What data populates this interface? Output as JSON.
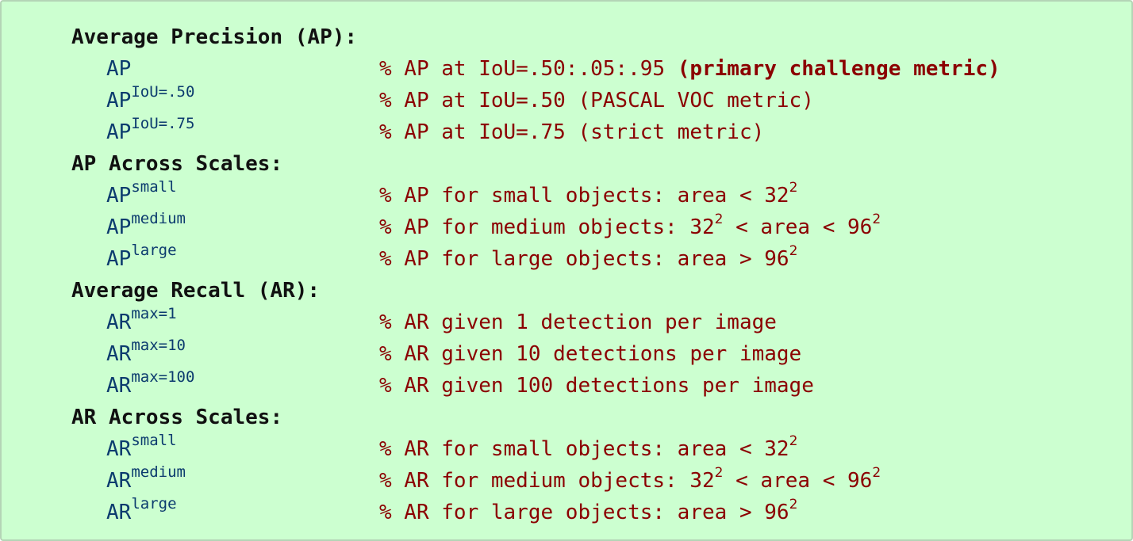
{
  "sections": [
    {
      "heading": "Average Precision (AP):",
      "rows": [
        {
          "base": "AP",
          "sup": "",
          "desc": [
            {
              "t": "% AP at IoU=.50:.05:.95 "
            },
            {
              "t": "(primary challenge metric)",
              "b": true
            }
          ]
        },
        {
          "base": "AP",
          "sup": "IoU=.50",
          "desc": [
            {
              "t": "% AP at IoU=.50 (PASCAL VOC metric)"
            }
          ]
        },
        {
          "base": "AP",
          "sup": "IoU=.75",
          "desc": [
            {
              "t": "% AP at IoU=.75 (strict metric)"
            }
          ]
        }
      ]
    },
    {
      "heading": "AP Across Scales:",
      "rows": [
        {
          "base": "AP",
          "sup": "small",
          "desc": [
            {
              "t": "% AP for small objects: area < 32"
            },
            {
              "t": "2",
              "s": true
            }
          ]
        },
        {
          "base": "AP",
          "sup": "medium",
          "desc": [
            {
              "t": "% AP for medium objects: 32"
            },
            {
              "t": "2",
              "s": true
            },
            {
              "t": " < area < 96"
            },
            {
              "t": "2",
              "s": true
            }
          ]
        },
        {
          "base": "AP",
          "sup": "large",
          "desc": [
            {
              "t": "% AP for large objects: area > 96"
            },
            {
              "t": "2",
              "s": true
            }
          ]
        }
      ]
    },
    {
      "heading": "Average Recall (AR):",
      "rows": [
        {
          "base": "AR",
          "sup": "max=1",
          "desc": [
            {
              "t": "% AR given 1 detection per image"
            }
          ]
        },
        {
          "base": "AR",
          "sup": "max=10",
          "desc": [
            {
              "t": "% AR given 10 detections per image"
            }
          ]
        },
        {
          "base": "AR",
          "sup": "max=100",
          "desc": [
            {
              "t": "% AR given 100 detections per image"
            }
          ]
        }
      ]
    },
    {
      "heading": "AR Across Scales:",
      "rows": [
        {
          "base": "AR",
          "sup": "small",
          "desc": [
            {
              "t": "% AR for small objects: area < 32"
            },
            {
              "t": "2",
              "s": true
            }
          ]
        },
        {
          "base": "AR",
          "sup": "medium",
          "desc": [
            {
              "t": "% AR for medium objects: 32"
            },
            {
              "t": "2",
              "s": true
            },
            {
              "t": " < area < 96"
            },
            {
              "t": "2",
              "s": true
            }
          ]
        },
        {
          "base": "AR",
          "sup": "large",
          "desc": [
            {
              "t": "% AR for large objects: area > 96"
            },
            {
              "t": "2",
              "s": true
            }
          ]
        }
      ]
    }
  ]
}
